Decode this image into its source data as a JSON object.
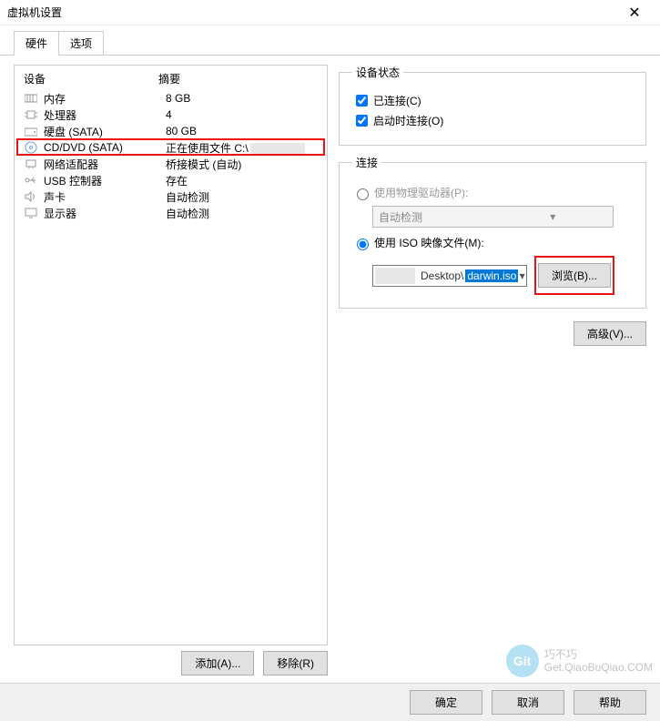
{
  "window": {
    "title": "虚拟机设置",
    "close": "✕"
  },
  "tabs": {
    "hardware": "硬件",
    "options": "选项"
  },
  "list": {
    "header_device": "设备",
    "header_summary": "摘要",
    "rows": [
      {
        "name": "内存",
        "summary": "8 GB"
      },
      {
        "name": "处理器",
        "summary": "4"
      },
      {
        "name": "硬盘 (SATA)",
        "summary": "80 GB"
      },
      {
        "name": "CD/DVD (SATA)",
        "summary": "正在使用文件 C:\\"
      },
      {
        "name": "网络适配器",
        "summary": "桥接模式 (自动)"
      },
      {
        "name": "USB 控制器",
        "summary": "存在"
      },
      {
        "name": "声卡",
        "summary": "自动检测"
      },
      {
        "name": "显示器",
        "summary": "自动检测"
      }
    ]
  },
  "buttons": {
    "add": "添加(A)...",
    "remove": "移除(R)",
    "browse": "浏览(B)...",
    "advanced": "高级(V)...",
    "ok": "确定",
    "cancel": "取消",
    "help": "帮助"
  },
  "status": {
    "legend": "设备状态",
    "connected": "已连接(C)",
    "connect_at_power": "启动时连接(O)"
  },
  "connection": {
    "legend": "连接",
    "use_physical": "使用物理驱动器(P):",
    "auto_detect": "自动检测",
    "use_iso": "使用 ISO 映像文件(M):",
    "iso_path_pre": "Desktop\\",
    "iso_path_sel": "darwin.iso"
  },
  "watermark": {
    "brand": "巧不巧",
    "url": "Get.QiaoBuQiao.COM"
  }
}
